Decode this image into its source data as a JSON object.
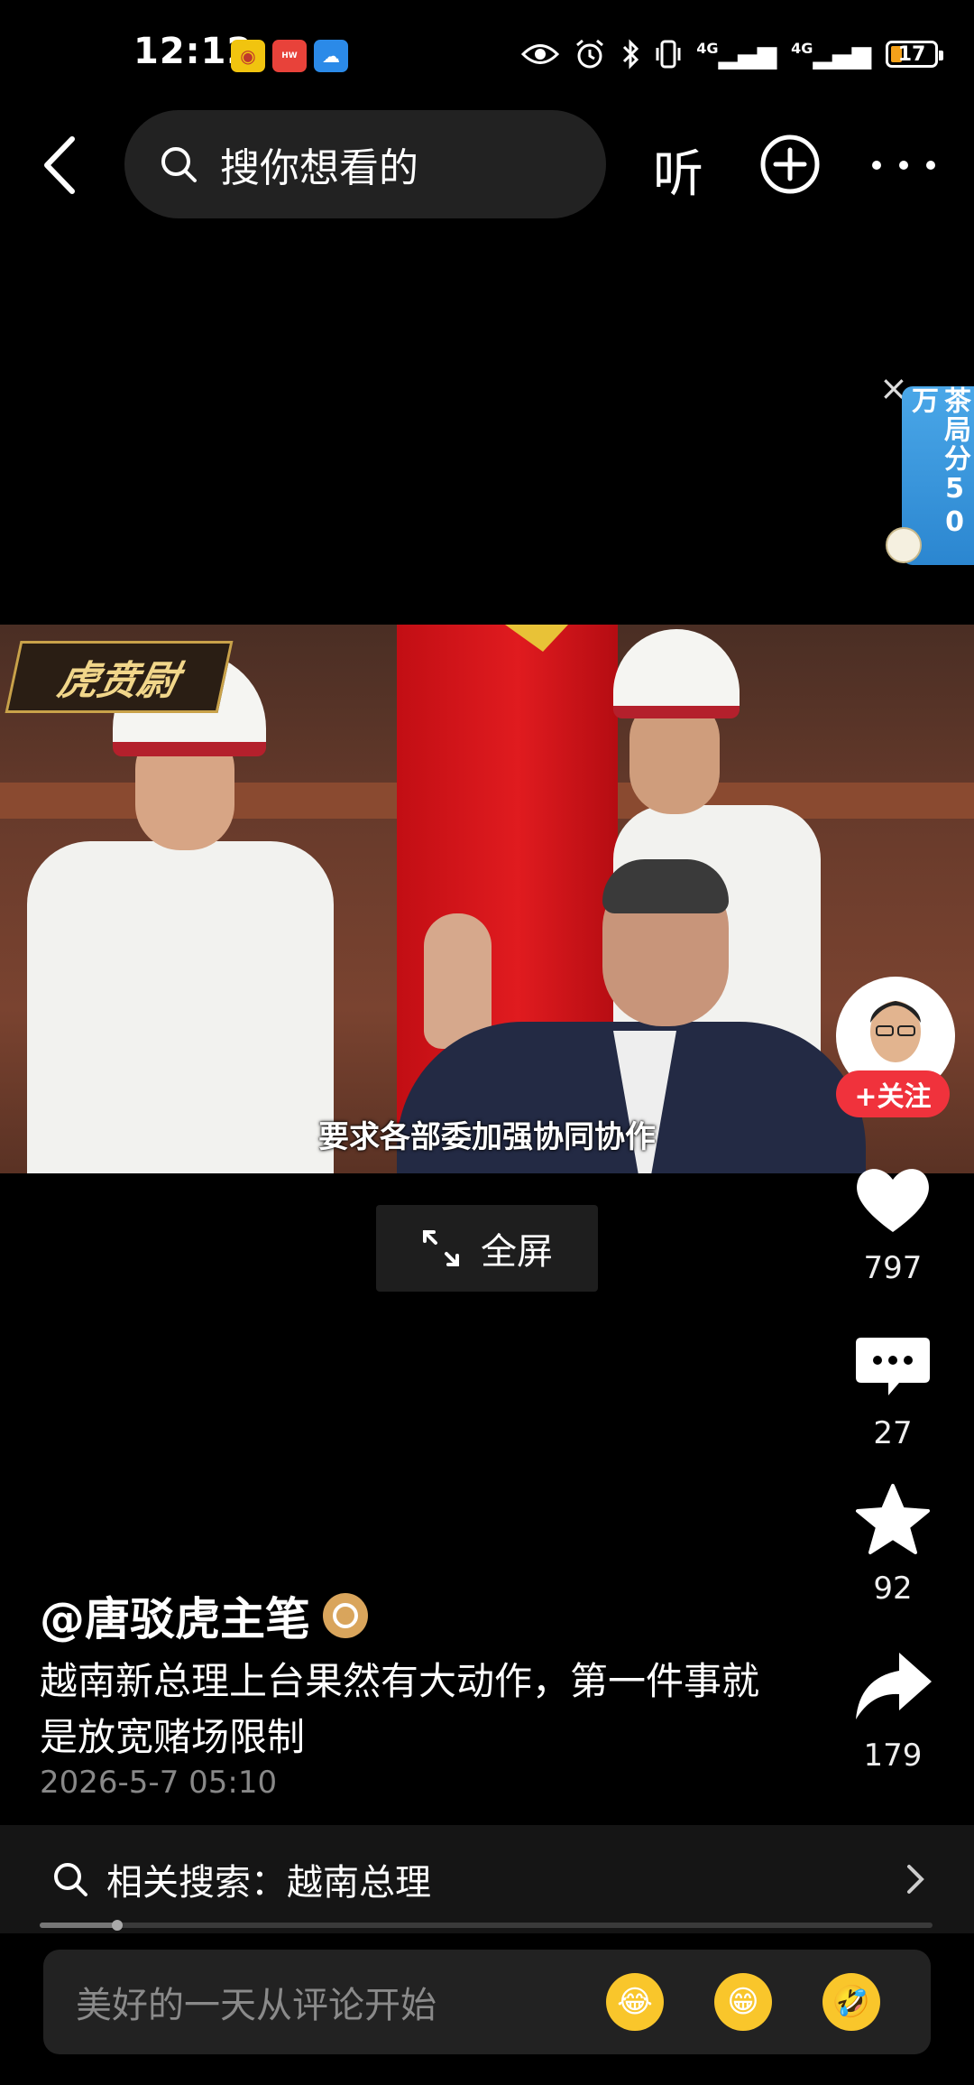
{
  "status_bar": {
    "time": "12:12",
    "battery": "17",
    "signal1": "4G",
    "signal2": "4G",
    "app_icons": [
      "weibo-icon",
      "huawei-icon",
      "weather-icon"
    ]
  },
  "top_bar": {
    "search_placeholder": "搜你想看的",
    "listen_label": "听"
  },
  "ad": {
    "text": "茶局分50万"
  },
  "video": {
    "logo_text": "虎贲尉",
    "subtitle": "要求各部委加强协同协作"
  },
  "fullscreen_label": "全屏",
  "actions": {
    "follow_label": "+关注",
    "likes": "797",
    "comments": "27",
    "favorites": "92",
    "shares": "179"
  },
  "post": {
    "author": "@唐驳虎主笔",
    "description": "越南新总理上台果然有大动作，第一件事就是放宽赌场限制",
    "date": "2026-5-7 05:10"
  },
  "related": {
    "label": "相关搜索：越南总理"
  },
  "playback_progress": 0.087,
  "comment_bar": {
    "placeholder": "美好的一天从评论开始",
    "emojis": [
      "laugh-cry-emoji",
      "grin-emoji",
      "rofl-emoji"
    ]
  },
  "colors": {
    "follow": "#f0323c",
    "battery_fill": "#f4a11a",
    "ad_blue": "#2b86d0"
  }
}
